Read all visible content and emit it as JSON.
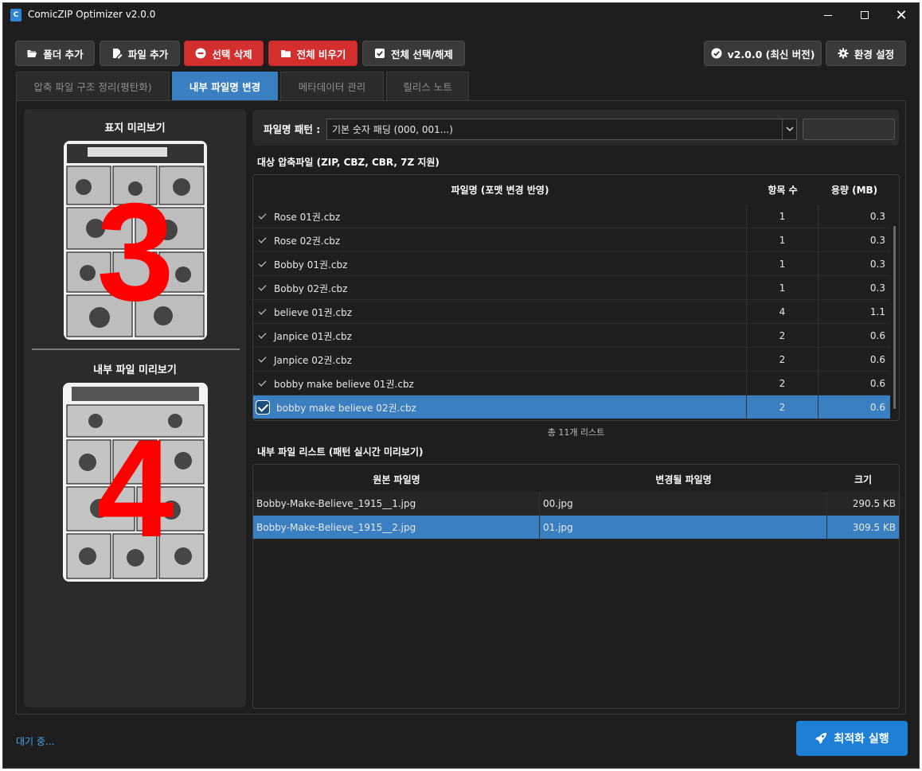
{
  "window": {
    "title": "ComicZIP Optimizer v2.0.0",
    "icon": "app-icon"
  },
  "toolbar": {
    "add_folder": "폴더 추가",
    "add_file": "파일 추가",
    "delete_selected": "선택 삭제",
    "clear_all": "전체 비우기",
    "select_all": "전체 선택/해제",
    "version": "v2.0.0 (최신 버전)",
    "settings": "환경 설정"
  },
  "tabs": [
    {
      "label": "압축 파일 구조 정리(평탄화)",
      "active": false
    },
    {
      "label": "내부 파일명 변경",
      "active": true
    },
    {
      "label": "메타데이터 관리",
      "active": false
    },
    {
      "label": "릴리스 노트",
      "active": false
    }
  ],
  "preview": {
    "cover_title": "표지 미리보기",
    "cover_number": "3",
    "inner_title": "내부 파일 미리보기",
    "inner_number": "4"
  },
  "pattern": {
    "label": "파일명 패턴 :",
    "selected": "기본 숫자 패딩 (000, 001...)",
    "extra_value": ""
  },
  "archives": {
    "section_label": "대상 압축파일 (ZIP, CBZ, CBR, 7Z 지원)",
    "columns": [
      "파일명 (포맷 변경 반영)",
      "항목 수",
      "용량 (MB)"
    ],
    "rows": [
      {
        "name": "Rose 01권.cbz",
        "count": "1",
        "size": "0.3",
        "selected": false
      },
      {
        "name": "Rose 02권.cbz",
        "count": "1",
        "size": "0.3",
        "selected": false
      },
      {
        "name": "Bobby 01권.cbz",
        "count": "1",
        "size": "0.3",
        "selected": false
      },
      {
        "name": "Bobby 02권.cbz",
        "count": "1",
        "size": "0.3",
        "selected": false
      },
      {
        "name": "believe 01권.cbz",
        "count": "4",
        "size": "1.1",
        "selected": false
      },
      {
        "name": "Janpice 01권.cbz",
        "count": "2",
        "size": "0.6",
        "selected": false
      },
      {
        "name": "Janpice 02권.cbz",
        "count": "2",
        "size": "0.6",
        "selected": false
      },
      {
        "name": "bobby make believe 01권.cbz",
        "count": "2",
        "size": "0.6",
        "selected": false
      },
      {
        "name": "bobby make believe 02권.cbz",
        "count": "2",
        "size": "0.6",
        "selected": true
      }
    ],
    "total_text": "총 11개 리스트"
  },
  "inner_files": {
    "section_label": "내부 파일 리스트 (패턴 실시간 미리보기)",
    "columns": [
      "원본 파일명",
      "변경될 파일명",
      "크기"
    ],
    "rows": [
      {
        "original": "Bobby-Make-Believe_1915__1.jpg",
        "renamed": "00.jpg",
        "size": "290.5 KB",
        "selected": false
      },
      {
        "original": "Bobby-Make-Believe_1915__2.jpg",
        "renamed": "01.jpg",
        "size": "309.5 KB",
        "selected": true
      }
    ]
  },
  "footer": {
    "status": "대기 중...",
    "run_button": "최적화 실행"
  },
  "colors": {
    "accent": "#3a7fc1",
    "danger": "#d32f2f",
    "run": "#1d7fd6",
    "background": "#1e1e1e",
    "panel": "#2b2b2b",
    "overlay_number": "#ff0000"
  }
}
